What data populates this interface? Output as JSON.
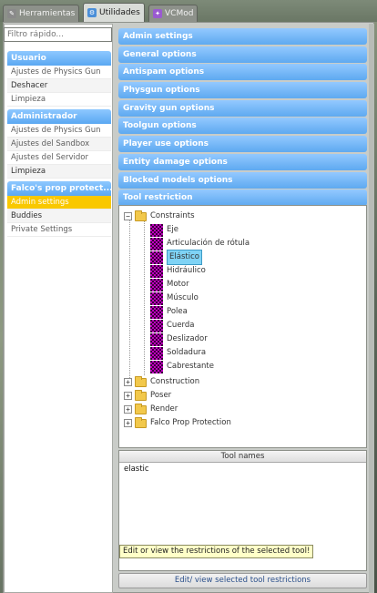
{
  "tabs": [
    {
      "label": "Herramientas",
      "icon": "wrench-icon",
      "color": "#8a8a8a",
      "active": false
    },
    {
      "label": "Utilidades",
      "icon": "utilities-icon",
      "color": "#4a8fd8",
      "active": true
    },
    {
      "label": "VCMod",
      "icon": "vcmod-icon",
      "color": "#9a5ad0",
      "active": false
    }
  ],
  "sidebar": {
    "filter_placeholder": "Filtro rápido...",
    "categories": [
      {
        "title": "Usuario",
        "items": [
          "Ajustes de Physics Gun",
          "Deshacer",
          "Limpieza"
        ]
      },
      {
        "title": "Administrador",
        "items": [
          "Ajustes de Physics Gun",
          "Ajustes del Sandbox",
          "Ajustes del Servidor",
          "Limpieza"
        ]
      },
      {
        "title": "Falco's prop protect...",
        "items": [
          "Admin settings",
          "Buddies",
          "Private Settings"
        ]
      }
    ],
    "selected_item": "Admin settings"
  },
  "sections": [
    "Admin settings",
    "General options",
    "Antispam options",
    "Physgun options",
    "Gravity gun options",
    "Toolgun options",
    "Player use options",
    "Entity damage options",
    "Blocked models options",
    "Tool restriction"
  ],
  "tree": {
    "root": {
      "label": "Constraints",
      "expander": "−"
    },
    "children": [
      "Eje",
      "Articulación de rótula",
      "Elástico",
      "Hidráulico",
      "Motor",
      "Músculo",
      "Polea",
      "Cuerda",
      "Deslizador",
      "Soldadura",
      "Cabrestante"
    ],
    "selected_child": "Elástico",
    "collapsed": [
      {
        "label": "Construction",
        "expander": "+"
      },
      {
        "label": "Poser",
        "expander": "+"
      },
      {
        "label": "Render",
        "expander": "+"
      },
      {
        "label": "Falco Prop Protection",
        "expander": "+"
      }
    ]
  },
  "tool_names": {
    "header": "Tool names",
    "rows": [
      "elastic"
    ]
  },
  "tooltip": "Edit or view the restrictions of the selected tool!",
  "edit_button": "Edit/ view selected tool restrictions",
  "colors": {
    "section_bar": "#5ea9f0",
    "selected_item": "#f9c800",
    "tree_selection": "#7fd3f5",
    "checkbox_pattern": "#c000c0"
  }
}
